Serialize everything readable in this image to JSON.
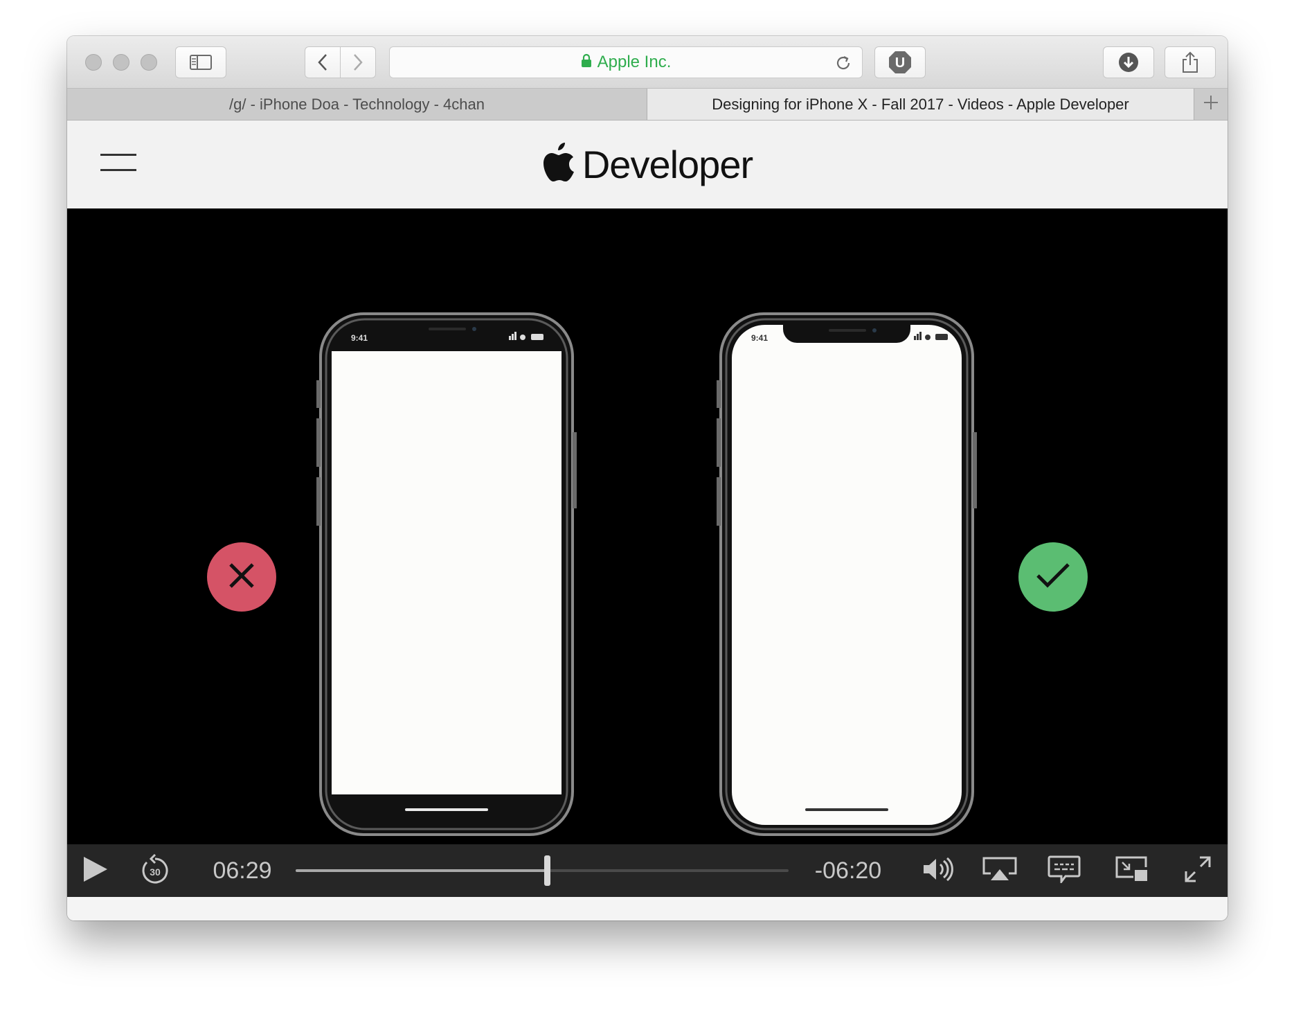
{
  "browser": {
    "address_site": "Apple Inc.",
    "tabs": [
      {
        "label": "/g/ - iPhone Doa - Technology - 4chan",
        "active": false
      },
      {
        "label": "Designing for iPhone X - Fall 2017 - Videos - Apple Developer",
        "active": true
      }
    ],
    "accent_green": "#2fad4d"
  },
  "page": {
    "brand": "Developer",
    "brand_icon": "apple-logo-icon"
  },
  "video": {
    "left_phone_time": "9:41",
    "right_phone_time": "9:41",
    "wrong_badge_color": "#d55366",
    "right_badge_color": "#5bbd72"
  },
  "player": {
    "elapsed": "06:29",
    "remaining": "-06:20",
    "progress": 0.51,
    "icons": [
      "play-icon",
      "skip-back-30-icon",
      "volume-icon",
      "airplay-icon",
      "captions-icon",
      "picture-in-picture-icon",
      "fullscreen-icon"
    ]
  }
}
